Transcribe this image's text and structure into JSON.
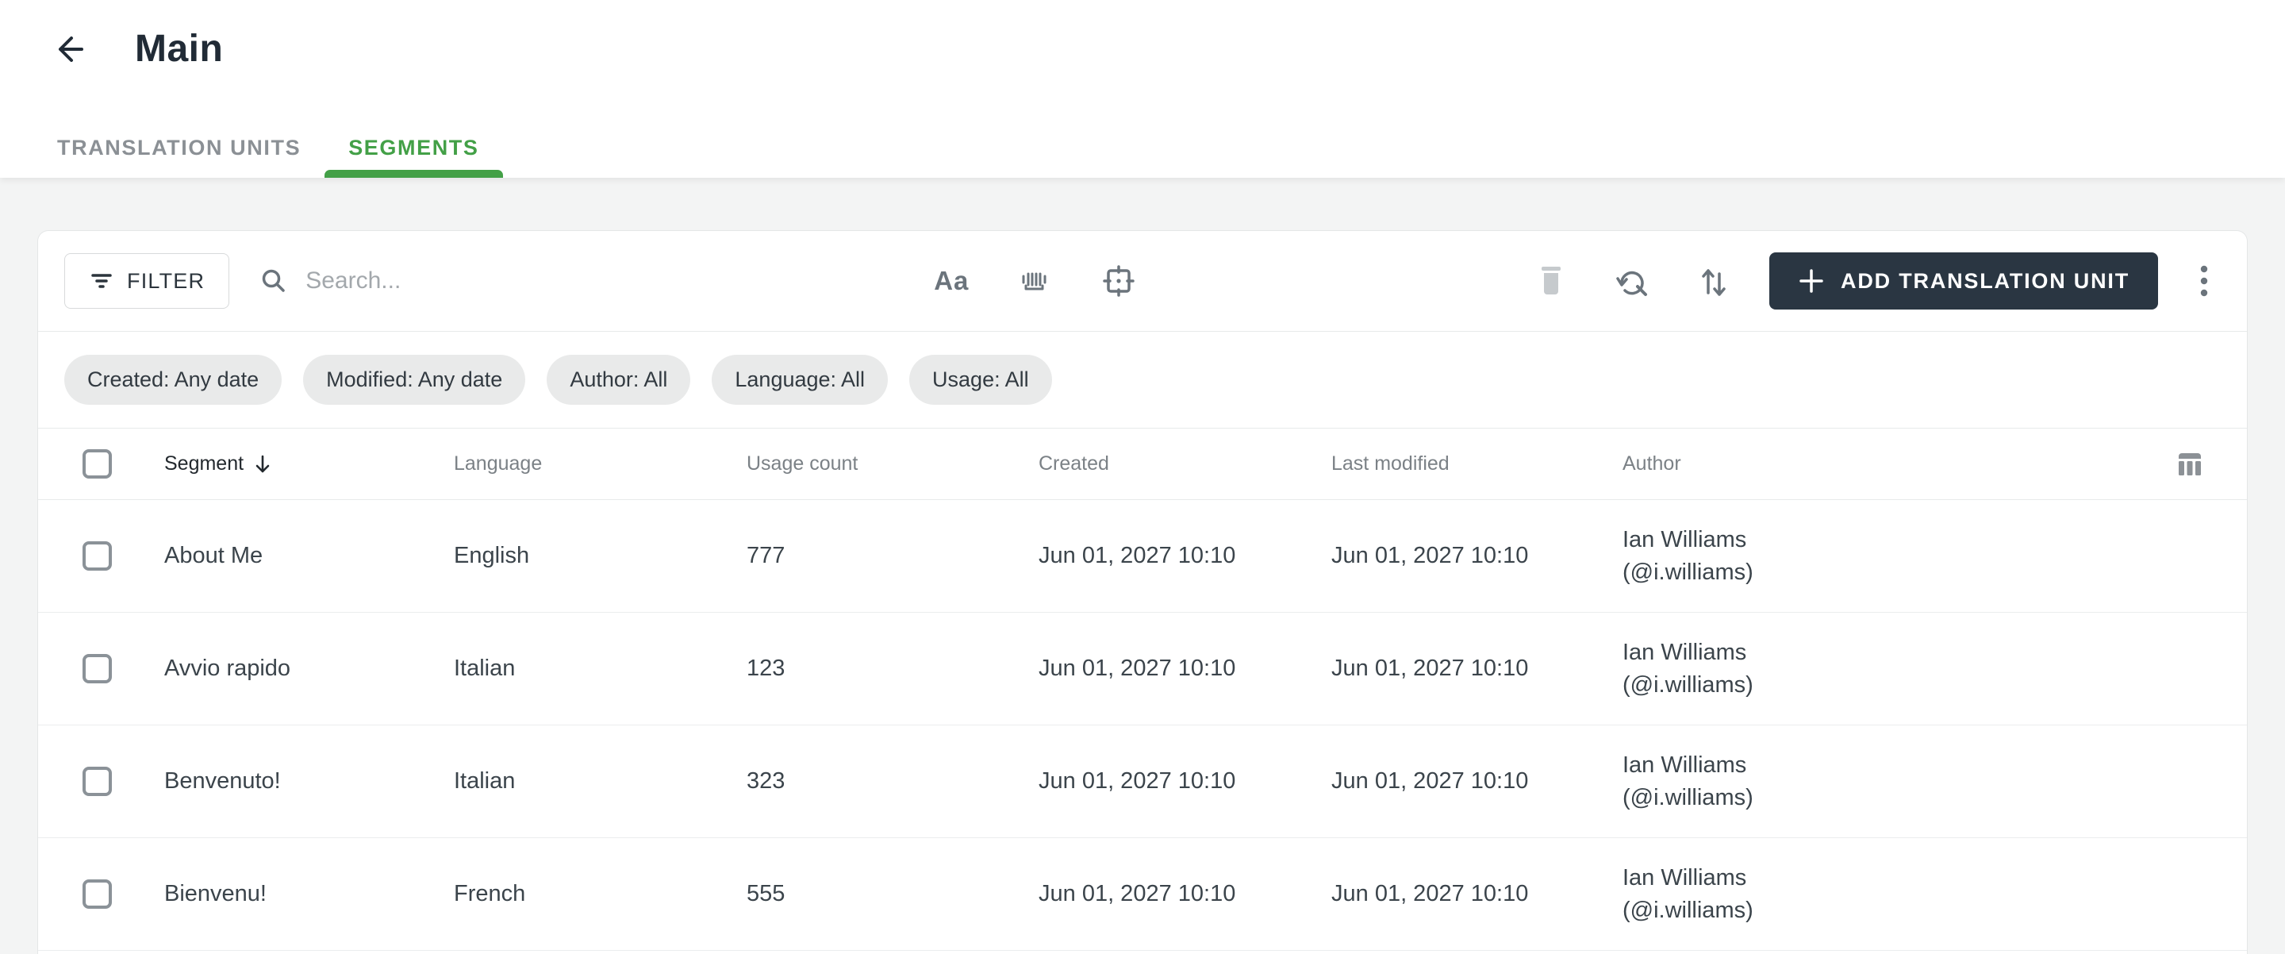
{
  "page": {
    "title": "Main"
  },
  "tabs": {
    "items": [
      {
        "label": "TRANSLATION UNITS"
      },
      {
        "label": "SEGMENTS"
      }
    ],
    "active": "SEGMENTS"
  },
  "toolbar": {
    "filter_label": "FILTER",
    "search_placeholder": "Search...",
    "search_value": "",
    "match_case_label": "Aa",
    "add_button_label": "ADD TRANSLATION UNIT",
    "icons": [
      "filter-icon",
      "search-icon",
      "match-case-icon",
      "match-whole-word-icon",
      "target-frame-icon",
      "trash-icon",
      "find-replace-icon",
      "sort-arrows-icon",
      "plus-icon",
      "kebab-menu-icon"
    ]
  },
  "filters": {
    "chips": [
      "Created: Any date",
      "Modified: Any date",
      "Author: All",
      "Language: All",
      "Usage: All"
    ]
  },
  "table": {
    "columns": {
      "segment": "Segment",
      "language": "Language",
      "usage": "Usage count",
      "created": "Created",
      "modified": "Last modified",
      "author": "Author"
    },
    "sorted_by": "Segment",
    "sort_direction": "desc",
    "rows": [
      {
        "segment": "About Me",
        "language": "English",
        "usage": "777",
        "created": "Jun 01, 2027 10:10",
        "modified": "Jun 01, 2027 10:10",
        "author_name": "Ian Williams",
        "author_handle": "(@i.williams)"
      },
      {
        "segment": "Avvio rapido",
        "language": "Italian",
        "usage": "123",
        "created": "Jun 01, 2027 10:10",
        "modified": "Jun 01, 2027 10:10",
        "author_name": "Ian Williams",
        "author_handle": "(@i.williams)"
      },
      {
        "segment": "Benvenuto!",
        "language": "Italian",
        "usage": "323",
        "created": "Jun 01, 2027 10:10",
        "modified": "Jun 01, 2027 10:10",
        "author_name": "Ian Williams",
        "author_handle": "(@i.williams)"
      },
      {
        "segment": "Bienvenu!",
        "language": "French",
        "usage": "555",
        "created": "Jun 01, 2027 10:10",
        "modified": "Jun 01, 2027 10:10",
        "author_name": "Ian Williams",
        "author_handle": "(@i.williams)"
      }
    ]
  },
  "colors": {
    "accent_green": "#43a047",
    "button_dark": "#2a3642",
    "text_dark": "#212b36",
    "page_bg": "#f3f4f4",
    "chip_bg": "#e9eaea"
  }
}
